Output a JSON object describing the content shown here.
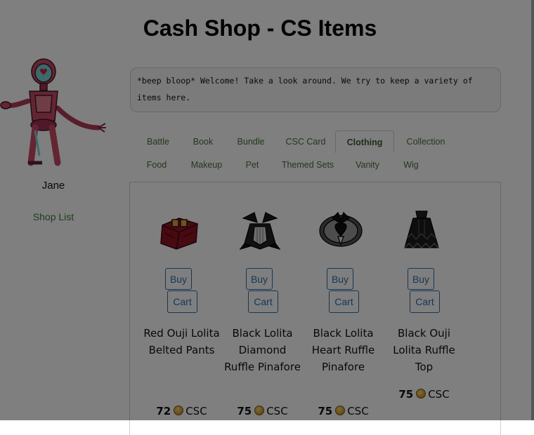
{
  "page": {
    "title": "Cash Shop - CS Items"
  },
  "npc": {
    "name": "Jane",
    "greeting": "*beep bloop* Welcome! Take a look around. We try to keep a variety of items here.",
    "shop_list_label": "Shop List"
  },
  "tabs": [
    {
      "label": "Battle"
    },
    {
      "label": "Book"
    },
    {
      "label": "Bundle"
    },
    {
      "label": "CSC Card"
    },
    {
      "label": "Clothing",
      "active": true
    },
    {
      "label": "Collection"
    },
    {
      "label": "Food"
    },
    {
      "label": "Makeup"
    },
    {
      "label": "Pet"
    },
    {
      "label": "Themed Sets"
    },
    {
      "label": "Vanity"
    },
    {
      "label": "Wig"
    }
  ],
  "buttons": {
    "buy_label": "Buy",
    "cart_label": "Cart"
  },
  "currency": {
    "label": "CSC",
    "icon": "coin-icon",
    "color": "#c9922a"
  },
  "items": [
    {
      "name": "Red Ouji Lolita Belted Pants",
      "price": "72"
    },
    {
      "name": "Black Lolita Diamond Ruffle Pinafore",
      "price": "75"
    },
    {
      "name": "Black Lolita Heart Ruffle Pinafore",
      "price": "75"
    },
    {
      "name": "Black Ouji Lolita Ruffle Top",
      "price": "75"
    }
  ],
  "colors": {
    "tab_text": "#4a6f3a",
    "button_border": "#2f6fa8",
    "link": "#3f7a3a"
  }
}
